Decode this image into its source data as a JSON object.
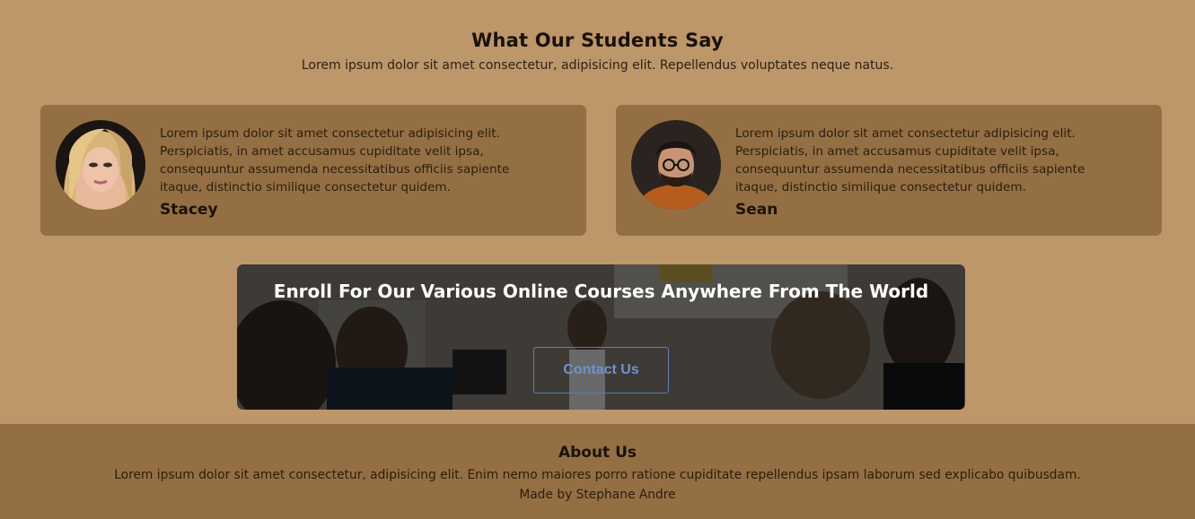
{
  "testimonials": {
    "title": "What Our Students Say",
    "subtitle": "Lorem ipsum dolor sit amet consectetur, adipisicing elit. Repellendus voluptates neque natus.",
    "cards": [
      {
        "text": "Lorem ipsum dolor sit amet consectetur adipisicing elit. Perspiciatis, in amet accusamus cupiditate velit ipsa, consequuntur assumenda necessitatibus officiis sapiente itaque, distinctio similique consectetur quidem.",
        "name": "Stacey",
        "avatar": "stacey-avatar"
      },
      {
        "text": "Lorem ipsum dolor sit amet consectetur adipisicing elit. Perspiciatis, in amet accusamus cupiditate velit ipsa, consequuntur assumenda necessitatibus officiis sapiente itaque, distinctio similique consectetur quidem.",
        "name": "Sean",
        "avatar": "sean-avatar"
      }
    ]
  },
  "banner": {
    "title": "Enroll For Our Various Online Courses Anywhere From The World",
    "button_label": "Contact Us"
  },
  "footer": {
    "title": "About Us",
    "text": "Lorem ipsum dolor sit amet consectetur, adipisicing elit. Enim nemo maiores porro ratione cupiditate repellendus ipsam laborum sed explicabo quibusdam.",
    "credit": "Made by Stephane Andre"
  },
  "colors": {
    "background": "#bd966a",
    "card": "#946f43",
    "footer": "#946f43",
    "button_border": "#5b7fb8",
    "button_text": "#6d92cf"
  }
}
